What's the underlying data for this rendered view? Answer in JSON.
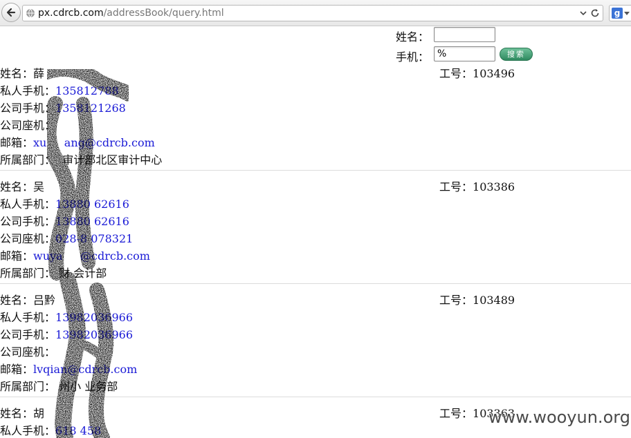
{
  "browser": {
    "url_host": "px.cdrcb.com",
    "url_path": "/addressBook/query.html",
    "search_engine_icon": "google-icon"
  },
  "query_form": {
    "name_label": "姓名：",
    "name_value": "",
    "mobile_label": "手机：",
    "mobile_value": "%",
    "search_button": "搜索"
  },
  "labels": {
    "name": "姓名：",
    "private_mobile": "私人手机：",
    "company_mobile": "公司手机：",
    "company_phone": "公司座机：",
    "email": "邮箱：",
    "department": "所属部门：",
    "employee_id": "工号："
  },
  "records": [
    {
      "name": "薛",
      "employee_id": "103496",
      "private_mobile": "135812788",
      "company_mobile": "1358121268",
      "company_phone": "",
      "email": "xu     ang@cdrcb.com",
      "department": "  审计部北区审计中心"
    },
    {
      "name": "吴",
      "employee_id": "103386",
      "private_mobile": "13880 62616",
      "company_mobile": "13880 62616",
      "company_phone": "028-8 078321",
      "email": "wuya     @cdrcb.com",
      "department": " 财 会计部"
    },
    {
      "name": "吕黔",
      "employee_id": "103489",
      "private_mobile": "13982036966",
      "company_mobile": "13982036966",
      "company_phone": "",
      "email": "lvqian@cdrcb.com",
      "department": " 州小 业务部"
    },
    {
      "name": "胡",
      "employee_id": "103363",
      "private_mobile": "618 458",
      "company_mobile": "",
      "company_phone": "",
      "email": "",
      "department": ""
    }
  ],
  "watermark": "www.wooyun.org"
}
